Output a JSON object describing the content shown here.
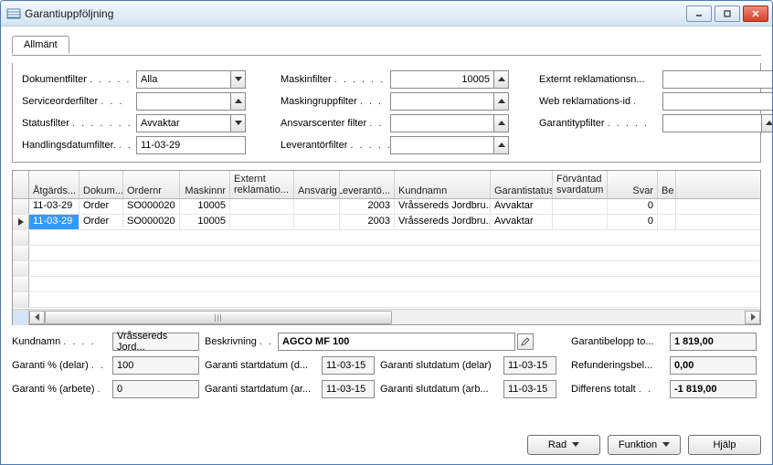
{
  "window": {
    "title": "Garantiuppföljning"
  },
  "tabs": [
    {
      "label": "Allmänt"
    }
  ],
  "filters": {
    "col1": {
      "dokumentfilter": {
        "label": "Dokumentfilter",
        "value": "Alla"
      },
      "serviceorderfilter": {
        "label": "Serviceorderfilter",
        "value": ""
      },
      "statusfilter": {
        "label": "Statusfilter",
        "value": "Avvaktar"
      },
      "handlingsdatumfilter": {
        "label": "Handlingsdatumfilter.",
        "value": "11-03-29"
      }
    },
    "col2": {
      "maskinfilter": {
        "label": "Maskinfilter",
        "value": "10005"
      },
      "maskingruppfilter": {
        "label": "Maskingruppfilter",
        "value": ""
      },
      "ansvarscenterfilter": {
        "label": "Ansvarscenter filter",
        "value": ""
      },
      "leverantorfilter": {
        "label": "Leverantörfilter",
        "value": ""
      }
    },
    "col3": {
      "externt": {
        "label": "Externt reklamationsn...",
        "value": ""
      },
      "web": {
        "label": "Web reklamations-id",
        "value": ""
      },
      "garantityp": {
        "label": "Garantitypfilter",
        "value": ""
      }
    }
  },
  "grid": {
    "headers": {
      "atgard": "Åtgärds...",
      "dokum": "Dokum...",
      "ordernr": "Ordernr",
      "maskinnr": "Maskinnr",
      "externt": "Externt reklamatio...",
      "ansvarig": "Ansvarig",
      "leveranto": "Leverantö...",
      "kundnamn": "Kundnamn",
      "garantistatus": "Garantistatus",
      "forvantad": "Förväntad svardatum",
      "svar": "Svar",
      "be": "Be"
    },
    "rows": [
      {
        "atgard": "11-03-29",
        "dokum": "Order",
        "ordernr": "SO000020",
        "maskinnr": "10005",
        "externt": "",
        "ansvarig": "",
        "leveranto": "2003",
        "kundnamn": "Vråssereds Jordbru...",
        "garantistatus": "Avvaktar",
        "forvantad": "",
        "svar": "0"
      },
      {
        "atgard": "11-03-29",
        "dokum": "Order",
        "ordernr": "SO000020",
        "maskinnr": "10005",
        "externt": "",
        "ansvarig": "",
        "leveranto": "2003",
        "kundnamn": "Vråssereds Jordbru...",
        "garantistatus": "Avvaktar",
        "forvantad": "",
        "svar": "0"
      }
    ]
  },
  "detail": {
    "kundnamn": {
      "label": "Kundnamn",
      "value": "Vråssereds Jord..."
    },
    "beskrivning": {
      "label": "Beskrivning",
      "value": "AGCO MF 100"
    },
    "garanti_pct_delar": {
      "label": "Garanti % (delar)",
      "value": "100"
    },
    "garanti_start_delar": {
      "label": "Garanti startdatum (d...",
      "value": "11-03-15"
    },
    "garanti_slut_delar": {
      "label": "Garanti slutdatum (delar)",
      "value": "11-03-15"
    },
    "garanti_pct_arbete": {
      "label": "Garanti % (arbete)",
      "value": "0"
    },
    "garanti_start_arbete": {
      "label": "Garanti startdatum (ar...",
      "value": "11-03-15"
    },
    "garanti_slut_arbete": {
      "label": "Garanti slutdatum (arb...",
      "value": "11-03-15"
    },
    "garantibelopp": {
      "label": "Garantibelopp to...",
      "value": "1 819,00"
    },
    "refunderingsbel": {
      "label": "Refunderingsbel...",
      "value": "0,00"
    },
    "differens": {
      "label": "Differens totalt",
      "value": "-1 819,00"
    }
  },
  "footer": {
    "rad": "Rad",
    "funktion": "Funktion",
    "hjalp": "Hjälp"
  }
}
